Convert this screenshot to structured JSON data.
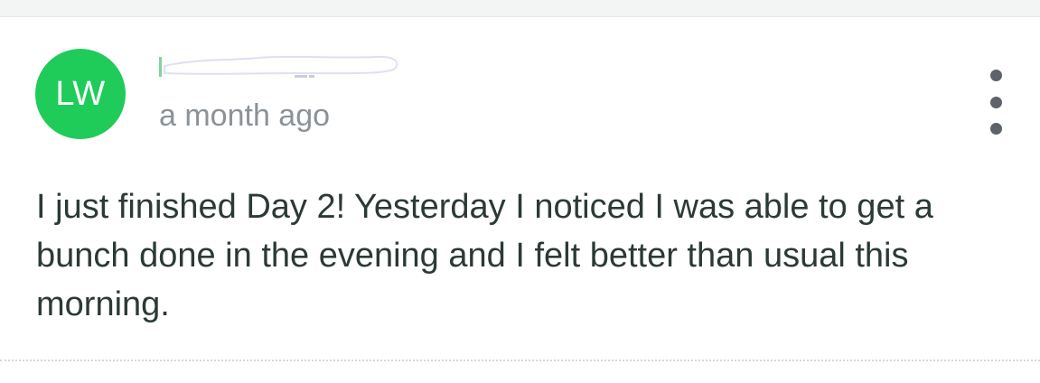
{
  "comment": {
    "avatar_initials": "LW",
    "timestamp": "a month ago",
    "body": "I just finished Day 2! Yesterday I noticed I was able to get a bunch done in the evening and I felt better than usual this morning.",
    "more_icon": "more-vertical-icon"
  },
  "colors": {
    "avatar_bg": "#1fcc59",
    "text": "#2c3a35",
    "muted": "#8b9298"
  }
}
